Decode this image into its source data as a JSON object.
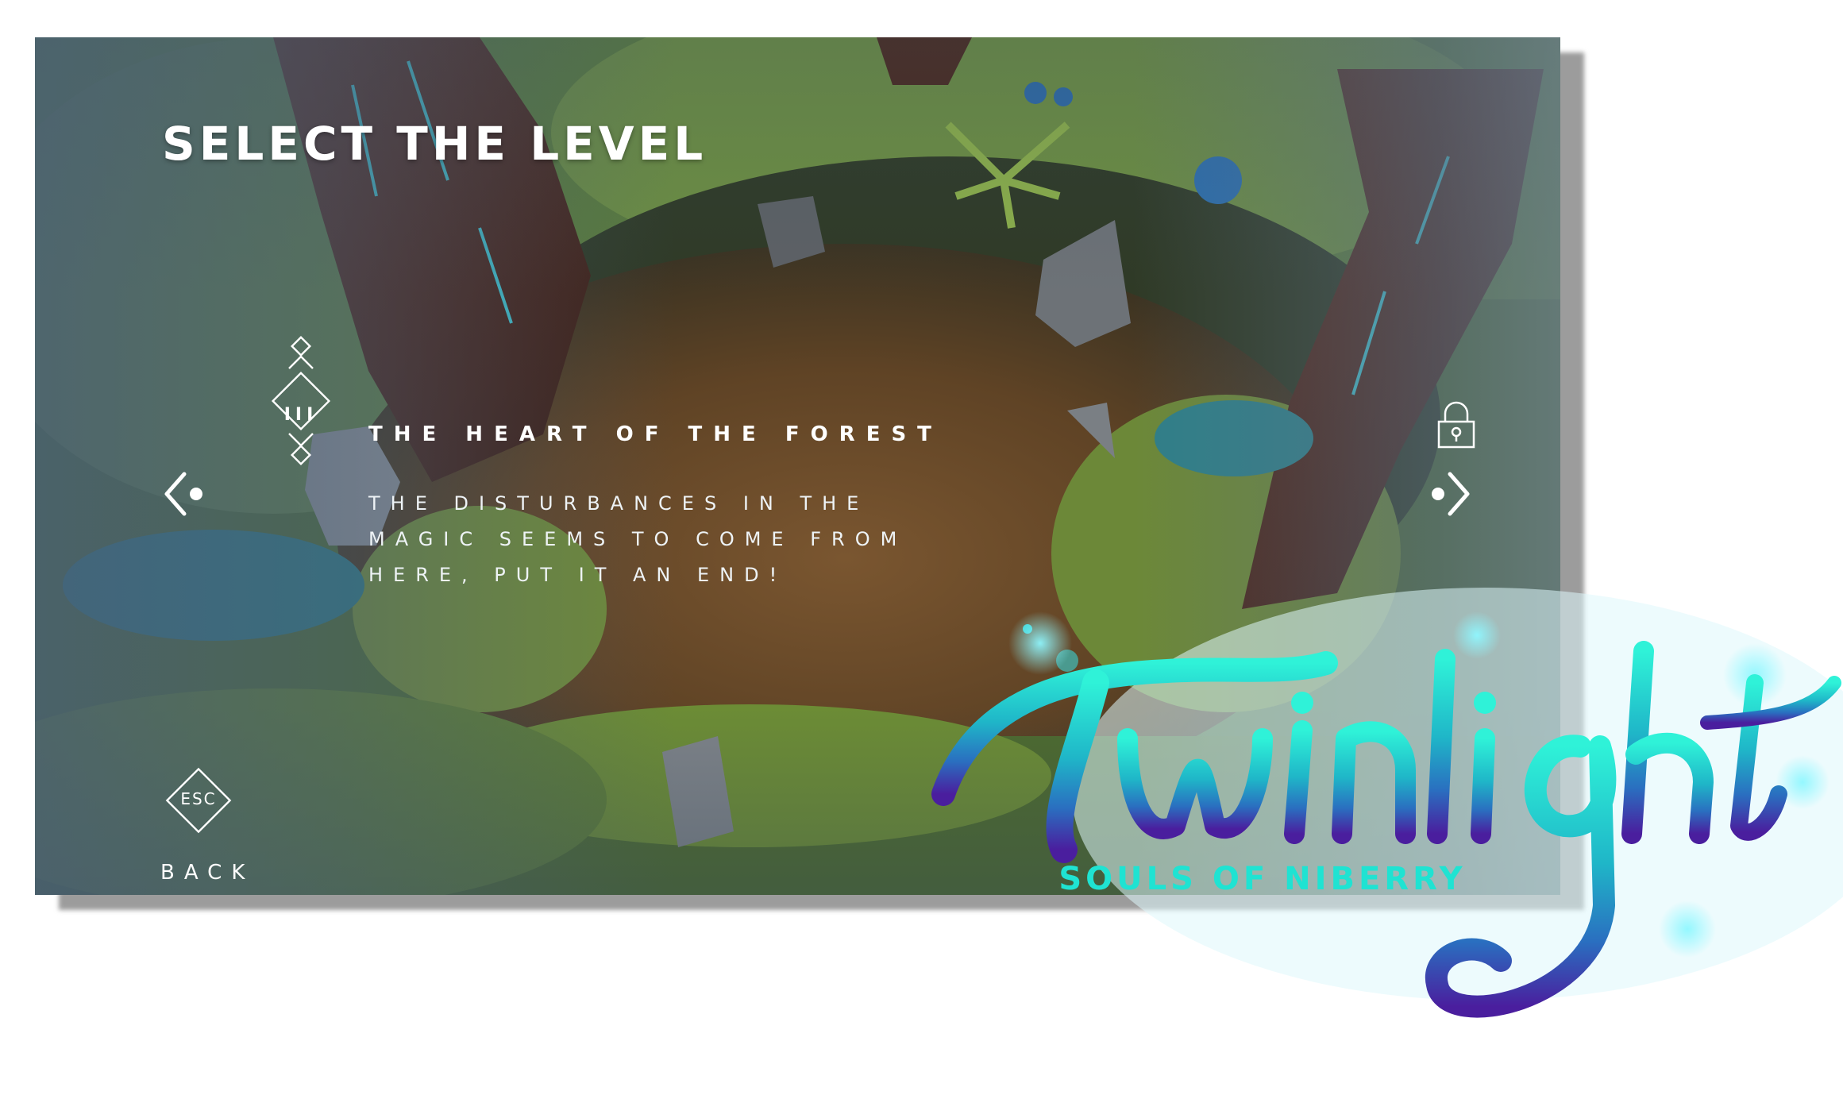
{
  "screen": {
    "title": "SELECT THE LEVEL"
  },
  "level": {
    "numeral": "III",
    "name": "THE HEART OF THE FOREST",
    "description": "The disturbances in the magic seems to come from here, put it an end!",
    "next_locked": true
  },
  "navigation": {
    "prev_icon": "chevron-left-icon",
    "next_icon": "chevron-right-icon",
    "lock_icon": "padlock-icon"
  },
  "controls": {
    "esc_key": "ESC",
    "back_label": "BACK"
  },
  "logo": {
    "name": "Twinlight",
    "subtitle": "SOULS OF NIBERRY"
  },
  "colors": {
    "accent_teal": "#1fe3d2",
    "accent_purple": "#5a2fb0",
    "ui_text": "#ffffff"
  }
}
